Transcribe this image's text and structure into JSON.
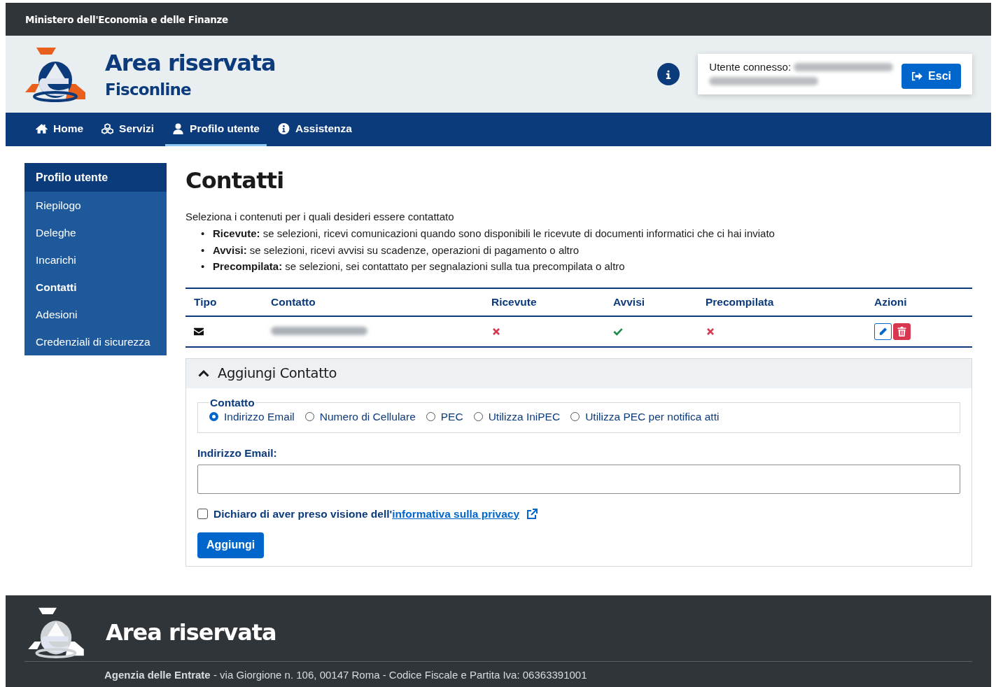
{
  "topbar": {
    "title": "Ministero dell'Economia e delle Finanze"
  },
  "header": {
    "title": "Area riservata",
    "subtitle": "Fisconline",
    "user_box": {
      "label": "Utente connesso:",
      "logout_button": "Esci"
    }
  },
  "nav": [
    {
      "label": "Home",
      "selected": false
    },
    {
      "label": "Servizi",
      "selected": false
    },
    {
      "label": "Profilo utente",
      "selected": true
    },
    {
      "label": "Assistenza",
      "selected": false
    }
  ],
  "sidebar": {
    "title": "Profilo utente",
    "items": [
      {
        "label": "Riepilogo",
        "selected": false
      },
      {
        "label": "Deleghe",
        "selected": false
      },
      {
        "label": "Incarichi",
        "selected": false
      },
      {
        "label": "Contatti",
        "selected": true
      },
      {
        "label": "Adesioni",
        "selected": false
      },
      {
        "label": "Credenziali di sicurezza",
        "selected": false
      }
    ]
  },
  "main": {
    "title": "Contatti",
    "intro": "Seleziona i contenuti per i quali desideri essere contattato",
    "bullets": [
      {
        "marker": "•",
        "text": "**Ricevute:** se selezioni, ricevi comunicazioni quando sono disponibili le ricevute di documenti informatici che ci hai inviato"
      },
      {
        "marker": "•",
        "text": "**Avvisi:** se selezioni, ricevi avvisi su scadenze, operazioni di pagamento o altro"
      },
      {
        "marker": "•",
        "text": "**Precompilata:** se selezioni, sei contattato per segnalazioni sulla tua precompilata o altro"
      }
    ],
    "table": {
      "columns": [
        "Tipo",
        "Contatto",
        "Ricevute",
        "Avvisi",
        "Precompilata",
        "Azioni"
      ],
      "rows": [
        {
          "ricevute": false,
          "avvisi": true,
          "precompilata": false
        }
      ]
    },
    "add_section": {
      "title": "Aggiungi Contatto",
      "expanded": true,
      "legend": "Contatto",
      "options": [
        {
          "label": "Indirizzo Email",
          "selected": true
        },
        {
          "label": "Numero di Cellulare",
          "selected": false
        },
        {
          "label": "PEC",
          "selected": false
        },
        {
          "label": "Utilizza IniPEC",
          "selected": false
        },
        {
          "label": "Utilizza PEC per notifica atti",
          "selected": false
        }
      ],
      "field_label": "Indirizzo Email:",
      "consent": {
        "text": "Dichiaro di aver preso visione dell'",
        "link": "informativa sulla privacy",
        "checked": false
      },
      "submit": "Aggiungi"
    }
  },
  "footer": {
    "title": "Area riservata",
    "address": "**Agenzia delle Entrate** - via Giorgione n. 106, 00147 Roma - Codice Fiscale e Partita Iva: 06363391001"
  }
}
